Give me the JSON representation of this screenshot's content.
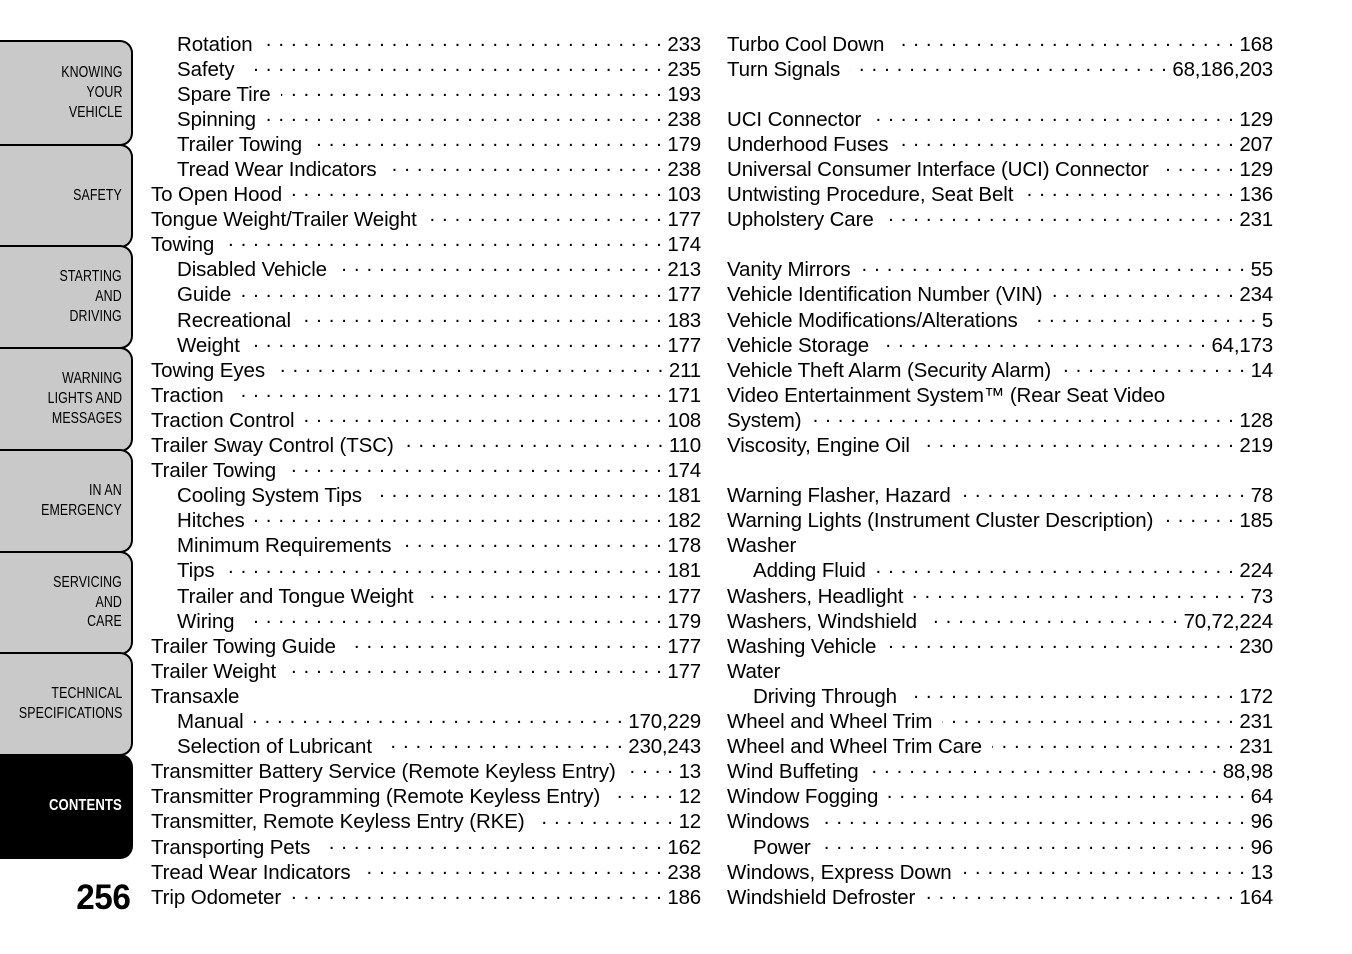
{
  "page_number": "256",
  "sidebar": {
    "tabs": [
      {
        "label": "KNOWING\nYOUR\nVEHICLE",
        "active": false
      },
      {
        "label": "SAFETY",
        "active": false
      },
      {
        "label": "STARTING\nAND\nDRIVING",
        "active": false
      },
      {
        "label": "WARNING\nLIGHTS AND\nMESSAGES",
        "active": false
      },
      {
        "label": "IN AN\nEMERGENCY",
        "active": false
      },
      {
        "label": "SERVICING\nAND\nCARE",
        "active": false
      },
      {
        "label": "TECHNICAL\nSPECIFICATIONS",
        "active": false
      },
      {
        "label": "CONTENTS",
        "active": true
      }
    ]
  },
  "colors": {
    "tab_background": "#c9c9c9",
    "tab_border": "#000000",
    "tab_active_background": "#000000",
    "tab_active_text": "#ffffff",
    "page_background": "#ffffff",
    "text": "#000000"
  },
  "index": {
    "left_column": [
      {
        "title": "Rotation",
        "page": "233",
        "indent": true
      },
      {
        "title": "Safety",
        "page": "235",
        "indent": true
      },
      {
        "title": "Spare Tire",
        "page": "193",
        "indent": true
      },
      {
        "title": "Spinning",
        "page": "238",
        "indent": true
      },
      {
        "title": "Trailer Towing",
        "page": "179",
        "indent": true
      },
      {
        "title": "Tread Wear Indicators",
        "page": "238",
        "indent": true
      },
      {
        "title": "To Open Hood",
        "page": "103",
        "indent": false
      },
      {
        "title": "Tongue Weight/Trailer Weight",
        "page": "177",
        "indent": false
      },
      {
        "title": "Towing",
        "page": "174",
        "indent": false
      },
      {
        "title": "Disabled Vehicle",
        "page": "213",
        "indent": true
      },
      {
        "title": "Guide",
        "page": "177",
        "indent": true
      },
      {
        "title": "Recreational",
        "page": "183",
        "indent": true
      },
      {
        "title": "Weight",
        "page": "177",
        "indent": true
      },
      {
        "title": "Towing Eyes",
        "page": "211",
        "indent": false
      },
      {
        "title": "Traction",
        "page": "171",
        "indent": false
      },
      {
        "title": "Traction Control",
        "page": "108",
        "indent": false
      },
      {
        "title": "Trailer Sway Control (TSC)",
        "page": "110",
        "indent": false
      },
      {
        "title": "Trailer Towing",
        "page": "174",
        "indent": false
      },
      {
        "title": "Cooling System Tips",
        "page": "181",
        "indent": true
      },
      {
        "title": "Hitches",
        "page": "182",
        "indent": true
      },
      {
        "title": "Minimum Requirements",
        "page": "178",
        "indent": true
      },
      {
        "title": "Tips",
        "page": "181",
        "indent": true
      },
      {
        "title": "Trailer and Tongue Weight",
        "page": "177",
        "indent": true
      },
      {
        "title": "Wiring",
        "page": "179",
        "indent": true
      },
      {
        "title": "Trailer Towing Guide",
        "page": "177",
        "indent": false
      },
      {
        "title": "Trailer Weight",
        "page": "177",
        "indent": false
      },
      {
        "title": "Transaxle",
        "page": "",
        "indent": false,
        "heading": true
      },
      {
        "title": "Manual",
        "page": "170,229",
        "indent": true
      },
      {
        "title": "Selection of Lubricant",
        "page": "230,243",
        "indent": true
      },
      {
        "title": "Transmitter Battery Service (Remote Keyless Entry)",
        "page": "13",
        "indent": false
      },
      {
        "title": "Transmitter Programming (Remote Keyless Entry)",
        "page": "12",
        "indent": false
      },
      {
        "title": "Transmitter, Remote Keyless Entry (RKE)",
        "page": "12",
        "indent": false
      },
      {
        "title": "Transporting Pets",
        "page": "162",
        "indent": false
      },
      {
        "title": "Tread Wear Indicators",
        "page": "238",
        "indent": false
      },
      {
        "title": "Trip Odometer",
        "page": "186",
        "indent": false
      }
    ],
    "right_column": [
      {
        "title": "Turbo Cool Down",
        "page": "168",
        "indent": false
      },
      {
        "title": "Turn Signals",
        "page": "68,186,203",
        "indent": false
      },
      {
        "title": "",
        "page": "",
        "indent": false,
        "spacer": true
      },
      {
        "title": "UCI Connector",
        "page": "129",
        "indent": false
      },
      {
        "title": "Underhood Fuses",
        "page": "207",
        "indent": false
      },
      {
        "title": "Universal Consumer Interface (UCI) Connector",
        "page": "129",
        "indent": false
      },
      {
        "title": "Untwisting Procedure, Seat Belt",
        "page": "136",
        "indent": false
      },
      {
        "title": "Upholstery Care",
        "page": "231",
        "indent": false
      },
      {
        "title": "",
        "page": "",
        "indent": false,
        "spacer": true
      },
      {
        "title": "Vanity Mirrors",
        "page": "55",
        "indent": false
      },
      {
        "title": "Vehicle Identification Number (VIN)",
        "page": "234",
        "indent": false
      },
      {
        "title": "Vehicle Modifications/Alterations",
        "page": "5",
        "indent": false
      },
      {
        "title": "Vehicle Storage",
        "page": "64,173",
        "indent": false
      },
      {
        "title": "Vehicle Theft Alarm (Security Alarm)",
        "page": "14",
        "indent": false
      },
      {
        "title": "Video Entertainment System™ (Rear Seat Video",
        "page": "",
        "indent": false,
        "heading": true
      },
      {
        "title": "System)",
        "page": "128",
        "indent": false
      },
      {
        "title": "Viscosity, Engine Oil",
        "page": "219",
        "indent": false
      },
      {
        "title": "",
        "page": "",
        "indent": false,
        "spacer": true
      },
      {
        "title": "Warning Flasher, Hazard",
        "page": "78",
        "indent": false
      },
      {
        "title": "Warning Lights (Instrument Cluster Description)",
        "page": "185",
        "indent": false
      },
      {
        "title": "Washer",
        "page": "",
        "indent": false,
        "heading": true
      },
      {
        "title": "Adding Fluid",
        "page": "224",
        "indent": true
      },
      {
        "title": "Washers, Headlight",
        "page": "73",
        "indent": false
      },
      {
        "title": "Washers, Windshield",
        "page": "70,72,224",
        "indent": false
      },
      {
        "title": "Washing Vehicle",
        "page": "230",
        "indent": false
      },
      {
        "title": "Water",
        "page": "",
        "indent": false,
        "heading": true
      },
      {
        "title": "Driving Through",
        "page": "172",
        "indent": true
      },
      {
        "title": "Wheel and Wheel Trim",
        "page": "231",
        "indent": false
      },
      {
        "title": "Wheel and Wheel Trim Care",
        "page": "231",
        "indent": false
      },
      {
        "title": "Wind Buffeting",
        "page": "88,98",
        "indent": false
      },
      {
        "title": "Window Fogging",
        "page": "64",
        "indent": false
      },
      {
        "title": "Windows",
        "page": "96",
        "indent": false
      },
      {
        "title": "Power",
        "page": "96",
        "indent": true
      },
      {
        "title": "Windows, Express Down",
        "page": "13",
        "indent": false
      },
      {
        "title": "Windshield Defroster",
        "page": "164",
        "indent": false
      }
    ]
  }
}
